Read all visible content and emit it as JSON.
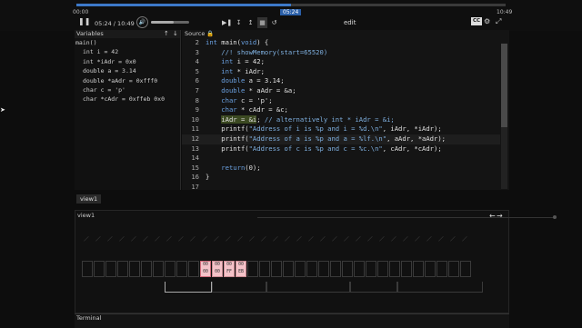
{
  "player": {
    "progress_pct": 50,
    "time_left_label": "00:00",
    "time_right_label": "10:49",
    "time_marker": "05:24",
    "time_display": "05:24 / 10:49",
    "volume_pct": 60,
    "edit_label": "edit",
    "cc_label": "CC"
  },
  "variables": {
    "title": "Variables",
    "function": "main()",
    "items": [
      "int i = 42",
      "int *iAdr = 0x0",
      "double a = 3.14",
      "double *aAdr = 0xfff0",
      "char c = 'p'",
      "char *cAdr = 0xffeb 0x0"
    ]
  },
  "source": {
    "title": "Source",
    "lines": [
      {
        "n": "2",
        "parts": [
          {
            "c": "kw",
            "t": "int"
          },
          {
            "c": "tx",
            "t": " main("
          },
          {
            "c": "kw",
            "t": "void"
          },
          {
            "c": "tx",
            "t": ") {"
          }
        ]
      },
      {
        "n": "3",
        "parts": [
          {
            "c": "cm",
            "t": "    //! showMemory(start=65520)"
          }
        ]
      },
      {
        "n": "4",
        "parts": [
          {
            "c": "kw",
            "t": "    int"
          },
          {
            "c": "tx",
            "t": " i = 42;"
          }
        ]
      },
      {
        "n": "5",
        "parts": [
          {
            "c": "kw",
            "t": "    int"
          },
          {
            "c": "tx",
            "t": " * iAdr;"
          }
        ]
      },
      {
        "n": "6",
        "parts": [
          {
            "c": "kw",
            "t": "    double"
          },
          {
            "c": "tx",
            "t": " a = 3.14;"
          }
        ]
      },
      {
        "n": "7",
        "parts": [
          {
            "c": "kw",
            "t": "    double"
          },
          {
            "c": "tx",
            "t": " * aAdr = &a;"
          }
        ]
      },
      {
        "n": "8",
        "parts": [
          {
            "c": "kw",
            "t": "    char"
          },
          {
            "c": "tx",
            "t": " c = 'p';"
          }
        ]
      },
      {
        "n": "9",
        "parts": [
          {
            "c": "kw",
            "t": "    char"
          },
          {
            "c": "tx",
            "t": " * cAdr = &c;"
          }
        ]
      },
      {
        "n": "10",
        "parts": [
          {
            "c": "tx",
            "t": "    "
          },
          {
            "c": "tx hl",
            "t": "iAdr = &i"
          },
          {
            "c": "tx",
            "t": "; "
          },
          {
            "c": "cm",
            "t": "// alternatively int * iAdr = &i;"
          }
        ]
      },
      {
        "n": "11",
        "parts": [
          {
            "c": "tx",
            "t": "    printf("
          },
          {
            "c": "cm",
            "t": "\"Address of i is %p and i = %d.\\n\""
          },
          {
            "c": "tx",
            "t": ", iAdr, *iAdr);"
          }
        ]
      },
      {
        "n": "12",
        "parts": [
          {
            "c": "tx",
            "t": "    printf("
          },
          {
            "c": "cm",
            "t": "\"Address of a is %p and a = %lf.\\n\""
          },
          {
            "c": "tx",
            "t": ", aAdr, *aAdr);"
          }
        ]
      },
      {
        "n": "13",
        "parts": [
          {
            "c": "tx",
            "t": "    printf("
          },
          {
            "c": "cm",
            "t": "\"Address of c is %p and c = %c.\\n\""
          },
          {
            "c": "tx",
            "t": ", cAdr, *cAdr);"
          }
        ]
      },
      {
        "n": "14",
        "parts": [
          {
            "c": "tx",
            "t": ""
          }
        ]
      },
      {
        "n": "15",
        "parts": [
          {
            "c": "kw",
            "t": "    return"
          },
          {
            "c": "tx",
            "t": "(0);"
          }
        ]
      },
      {
        "n": "16",
        "parts": [
          {
            "c": "tx",
            "t": "}"
          }
        ]
      },
      {
        "n": "17",
        "parts": [
          {
            "c": "tx",
            "t": ""
          }
        ]
      }
    ]
  },
  "view": {
    "tab_label": "view1",
    "panel_title": "view1"
  },
  "memory": {
    "cells_top": [
      "",
      "",
      "",
      "",
      "",
      "",
      "",
      "",
      "",
      "",
      "00",
      "00",
      "00",
      "00",
      "",
      "",
      "",
      "",
      "",
      "",
      "",
      "",
      "",
      "",
      "",
      "",
      "",
      "",
      "",
      "",
      "",
      "",
      ""
    ],
    "cells_bottom": [
      "",
      "",
      "",
      "",
      "",
      "",
      "",
      "",
      "",
      "",
      "00",
      "00",
      "FF",
      "EB",
      "",
      "",
      "",
      "",
      "",
      "",
      "",
      "",
      "",
      "",
      "",
      "",
      "",
      "",
      "",
      "",
      "",
      "",
      ""
    ]
  },
  "terminal": {
    "title": "Terminal"
  }
}
